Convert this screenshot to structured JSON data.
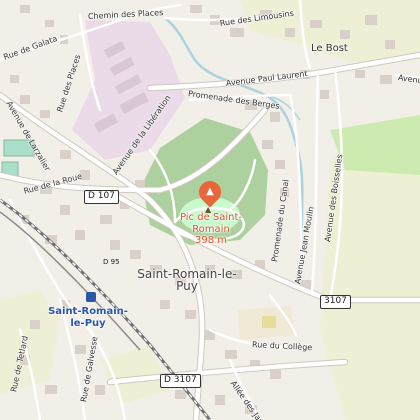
{
  "poi": {
    "name": "Pic de Saint-Romain",
    "elevation": "398 m",
    "icon": "mountain-peak-icon",
    "color": "#e8663a"
  },
  "town": {
    "name": "Saint-Romain-le-Puy"
  },
  "station": {
    "name": "Saint-Romain-le-Puy",
    "icon": "train-station-icon"
  },
  "places": {
    "le_bost": "Le Bost"
  },
  "roads": {
    "chemin_des_places": "Chemin des Places",
    "rue_des_limousins": "Rue des Limousins",
    "rue_de_galata": "Rue de Galata",
    "rue_des_places": "Rue des Places",
    "avenue_paul_laurent": "Avenue Paul Laurent",
    "promenade_des_berges": "Promenade des Berges",
    "avenue_de_larzalier": "Avenue de Larzalier",
    "avenue_de_la_liberation": "Avenue de la Libération",
    "avenue_jean_moulin": "Avenue Jean Moulin",
    "avenue_des_boisselles": "Avenue des Boisselles",
    "promenade_du_canal": "Promenade du Canal",
    "rue_de_la_roue": "Rue de la Roue",
    "rue_du_college": "Rue du Collège",
    "rue_de_tetlard": "Rue de Tetlard",
    "rue_de_galvesse": "Rue de Galvesse",
    "allee_des_jardins": "Allée des Jardins",
    "avenue_right_edge": "Avenue"
  },
  "shields": {
    "d107": "D 107",
    "d95": "D 95",
    "r3107": "3107",
    "d3107": "D 3107"
  },
  "colors": {
    "background": "#f2efe9",
    "forest": "#add19e",
    "park": "#c8facc",
    "industrial": "#ebdbe8",
    "farmland": "#eef0d5",
    "water": "#aad3df",
    "building": "#d9d0c9",
    "road": "#ffffff",
    "rail": "#707070"
  }
}
